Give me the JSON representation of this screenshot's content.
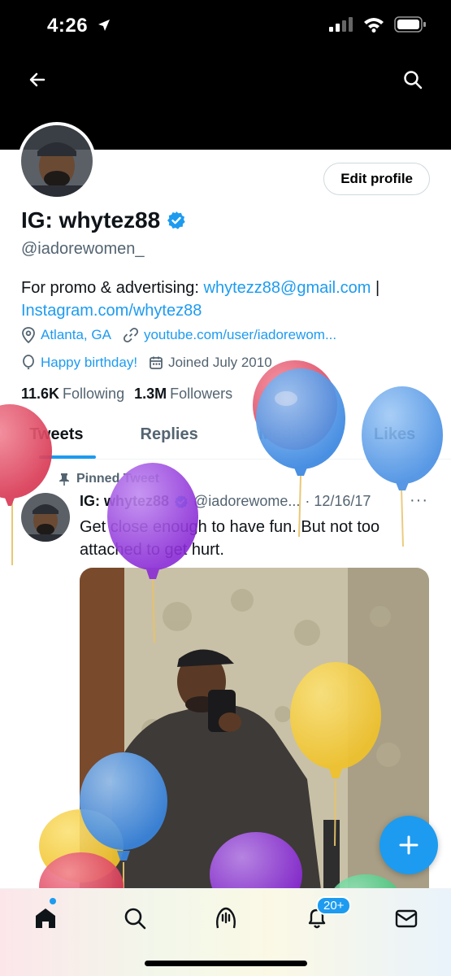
{
  "status_bar": {
    "time": "4:26"
  },
  "profile": {
    "name": "IG: whytez88",
    "handle": "@iadorewomen_",
    "edit_label": "Edit profile",
    "bio_prefix": "For promo & advertising: ",
    "bio_email": "whytezz88@gmail.com",
    "bio_sep": " |",
    "bio_link": "Instagram.com/whytez88",
    "location": "Atlanta, GA",
    "website": "youtube.com/user/iadorewom...",
    "birthday": "Happy birthday!",
    "joined": "Joined July 2010",
    "following_count": "11.6K",
    "following_label": "Following",
    "followers_count": "1.3M",
    "followers_label": "Followers"
  },
  "tabs": [
    "Tweets",
    "Replies",
    "Media",
    "Likes"
  ],
  "tweet": {
    "pinned_label": "Pinned Tweet",
    "author": "IG: whytez88",
    "handle": "@iadorewome...",
    "date": "· 12/16/17",
    "more": "···",
    "text": "Get close enough to have fun. But not too attached to get hurt."
  },
  "nav": {
    "notifications_badge": "20+"
  },
  "colors": {
    "accent": "#1d9bf0",
    "text": "#0f1419",
    "muted": "#536471"
  },
  "icons": [
    "back-arrow-icon",
    "search-icon",
    "verified-badge-icon",
    "location-icon",
    "link-icon",
    "balloon-icon",
    "calendar-icon",
    "pin-icon",
    "compose-icon",
    "home-icon",
    "spaces-icon",
    "bell-icon",
    "mail-icon"
  ]
}
